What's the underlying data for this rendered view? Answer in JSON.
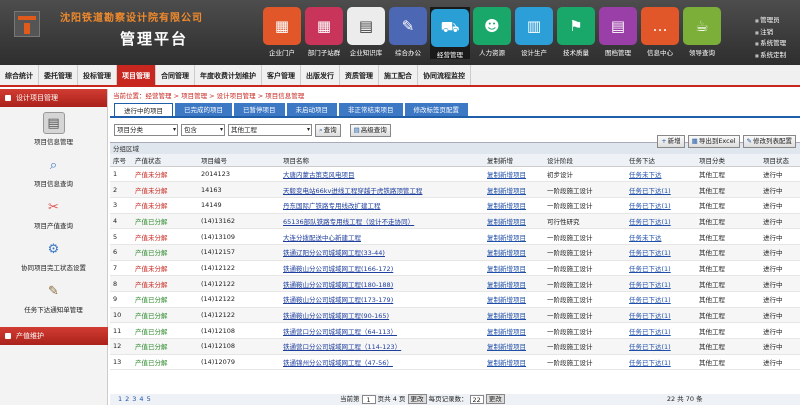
{
  "header": {
    "company": "沈阳铁道勘察设计院有限公司",
    "platform": "管理平台",
    "tiles": [
      {
        "label": "企业门户",
        "icon": "▦",
        "color": "#e2572a"
      },
      {
        "label": "部门子站群",
        "icon": "▦",
        "color": "#c9345a"
      },
      {
        "label": "企业知识库",
        "icon": "▤",
        "color": "#ececec"
      },
      {
        "label": "综合办公",
        "icon": "✎",
        "color": "#4c68b4"
      },
      {
        "label": "经营管理",
        "icon": "⛟",
        "color": "#2a9fd6"
      },
      {
        "label": "人力资源",
        "icon": "☻",
        "color": "#1aa86a"
      },
      {
        "label": "设计生产",
        "icon": "▥",
        "color": "#2d9fd8"
      },
      {
        "label": "技术质量",
        "icon": "⚑",
        "color": "#1aa86a"
      },
      {
        "label": "图档管理",
        "icon": "▤",
        "color": "#9b3fa8"
      },
      {
        "label": "信息中心",
        "icon": "…",
        "color": "#e2572a"
      },
      {
        "label": "领导查询",
        "icon": "☕",
        "color": "#7cae3a"
      }
    ],
    "active_tile": 4,
    "user_menu": [
      "管理员",
      "注销",
      "系统管理",
      "系统定制"
    ]
  },
  "nav": {
    "items": [
      "综合统计",
      "委托管理",
      "投标管理",
      "项目管理",
      "合同管理",
      "年度收费计划维护",
      "客户管理",
      "出版发行",
      "资质管理",
      "施工配合",
      "协同流程监控"
    ],
    "active": 3
  },
  "sidebar": {
    "title": "设计项目管理",
    "items": [
      {
        "label": "项目信息管理",
        "icon": "▤",
        "color": "#555"
      },
      {
        "label": "项目信息查询",
        "icon": "⌕",
        "color": "#3d78c5"
      },
      {
        "label": "项目产值查询",
        "icon": "✂",
        "color": "#d9534f"
      },
      {
        "label": "协同项目完工状态设置",
        "icon": "⚙",
        "color": "#3d78c5"
      },
      {
        "label": "任务下达通知单管理",
        "icon": "✎",
        "color": "#8a6d3b"
      }
    ],
    "bottom": "产值维护"
  },
  "main": {
    "crumb": "当前位置：经营管理 > 项目管理 > 设计项目管理 > 项目信息管理",
    "tabs": [
      "进行中的项目",
      "已完成的项目",
      "已暂停项目",
      "未启动项目",
      "非正常结束项目",
      "修改标签页配置"
    ],
    "active_tab": 0,
    "filters": {
      "field": "项目分类",
      "op": "包含",
      "value": "其他工程",
      "query": "查询",
      "advanced": "高级查询"
    },
    "right_buttons": [
      {
        "label": "新增",
        "icon": "+"
      },
      {
        "label": "导出到Excel",
        "icon": "▦"
      },
      {
        "label": "修改列表配置",
        "icon": "✎"
      }
    ],
    "area_title": "分组区域",
    "columns": [
      "序号",
      "产值状态",
      "项目编号",
      "项目名称",
      "复制新增",
      "设计阶段",
      "任务下达",
      "项目分类",
      "项目状态"
    ],
    "rows": [
      [
        "1",
        "产值未分解",
        "2014123",
        "大唐内蒙古策克风电项目",
        "复制新增项目",
        "初步设计",
        "任务未下达",
        "其他工程",
        "进行中"
      ],
      [
        "2",
        "产值未分解",
        "14163",
        "天毅变电站66kv进线工程穿越于虎铁路顶管工程",
        "复制新增项目",
        "一阶段施工设计",
        "任务已下达(1)",
        "其他工程",
        "进行中"
      ],
      [
        "3",
        "产值未分解",
        "14149",
        "丹东国际广铁路专用线改扩建工程",
        "复制新增项目",
        "一阶段施工设计",
        "任务已下达(1)",
        "其他工程",
        "进行中"
      ],
      [
        "4",
        "产值已分解",
        "(14)13162",
        "65136部队铁路专用线工程（设计不走协同）",
        "复制新增项目",
        "可行性研究",
        "任务已下达(1)",
        "其他工程",
        "进行中"
      ],
      [
        "5",
        "产值未分解",
        "(14)13109",
        "大连分拨配送中心新建工程",
        "复制新增项目",
        "一阶段施工设计",
        "任务未下达",
        "其他工程",
        "进行中"
      ],
      [
        "6",
        "产值已分解",
        "(14)12157",
        "铁通辽阳分公司城域网工程(33-44)",
        "复制新增项目",
        "一阶段施工设计",
        "任务已下达(1)",
        "其他工程",
        "进行中"
      ],
      [
        "7",
        "产值未分解",
        "(14)12122",
        "铁通鞍山分公司城域网工程(166-172)",
        "复制新增项目",
        "一阶段施工设计",
        "任务已下达(1)",
        "其他工程",
        "进行中"
      ],
      [
        "8",
        "产值未分解",
        "(14)12122",
        "铁通鞍山分公司城域网工程(180-188)",
        "复制新增项目",
        "一阶段施工设计",
        "任务已下达(1)",
        "其他工程",
        "进行中"
      ],
      [
        "9",
        "产值已分解",
        "(14)12122",
        "铁通鞍山分公司城域网工程(173-179)",
        "复制新增项目",
        "一阶段施工设计",
        "任务已下达(1)",
        "其他工程",
        "进行中"
      ],
      [
        "10",
        "产值已分解",
        "(14)12122",
        "铁通鞍山分公司城域网工程(90-165)",
        "复制新增项目",
        "一阶段施工设计",
        "任务已下达(1)",
        "其他工程",
        "进行中"
      ],
      [
        "11",
        "产值已分解",
        "(14)12108",
        "铁通营口分公司城域网工程（64-113）",
        "复制新增项目",
        "一阶段施工设计",
        "任务已下达(1)",
        "其他工程",
        "进行中"
      ],
      [
        "12",
        "产值已分解",
        "(14)12108",
        "铁通营口分公司城域网工程（114-123）",
        "复制新增项目",
        "一阶段施工设计",
        "任务已下达(1)",
        "其他工程",
        "进行中"
      ],
      [
        "13",
        "产值已分解",
        "(14)12079",
        "铁通锦州分公司城域网工程（47-56）",
        "复制新增项目",
        "一阶段施工设计",
        "任务已下达(1)",
        "其他工程",
        "进行中"
      ]
    ],
    "pager": {
      "pages": "1 2 3 4 5",
      "current": "当前第",
      "current_val": "1",
      "total": "页共 4 页",
      "go": "更改",
      "per": "每页记录数：",
      "per_val": "22",
      "go2": "更改",
      "right": "22 共 70 条"
    }
  }
}
